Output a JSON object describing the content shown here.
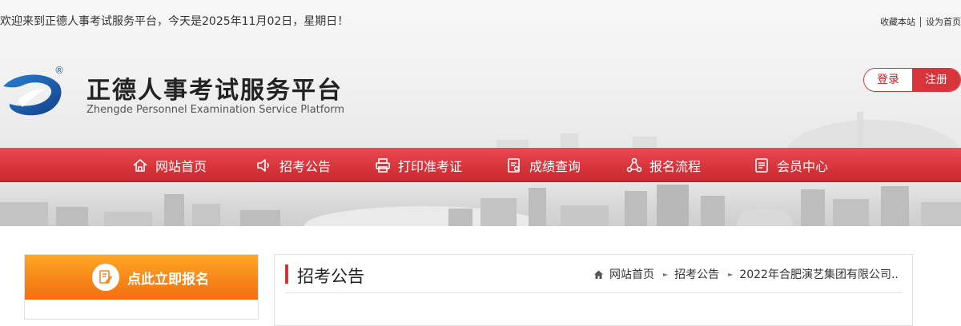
{
  "header": {
    "welcome": "欢迎来到正德人事考试服务平台，今天是2025年11月02日，星期日！",
    "favorite": "收藏本站",
    "homepage": "设为首页",
    "title": "正德人事考试服务平台",
    "subtitle": "Zhengde Personnel Examination Service Platform",
    "registered_mark": "®",
    "login": "登录",
    "register": "注册"
  },
  "nav": {
    "items": [
      {
        "label": "网站首页",
        "icon": "home-icon"
      },
      {
        "label": "招考公告",
        "icon": "speaker-icon"
      },
      {
        "label": "打印准考证",
        "icon": "printer-icon"
      },
      {
        "label": "成绩查询",
        "icon": "score-icon"
      },
      {
        "label": "报名流程",
        "icon": "process-icon"
      },
      {
        "label": "会员中心",
        "icon": "member-icon"
      }
    ]
  },
  "sidebar": {
    "signup": "点此立即报名",
    "icon": "edit-icon"
  },
  "main": {
    "title": "招考公告",
    "breadcrumb": [
      "网站首页",
      "招考公告",
      "2022年合肥演艺集团有限公司.."
    ]
  },
  "colors": {
    "brand_red": "#d8343b",
    "signup_orange": "#f7871a",
    "logo_blue": "#1b5fb0"
  }
}
